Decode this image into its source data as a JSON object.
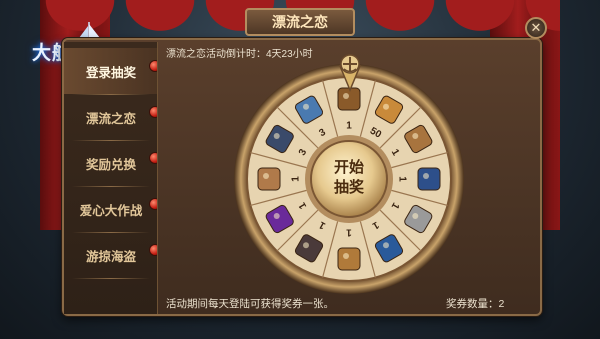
{
  "logo": {
    "title": "大航海之路"
  },
  "header": {
    "title": "漂流之恋",
    "close_label": "✕"
  },
  "countdown": {
    "label": "漂流之恋活动倒计时：",
    "value": "4天23小时"
  },
  "sidebar": {
    "items": [
      {
        "label": "登录抽奖",
        "active": true
      },
      {
        "label": "漂流之恋",
        "active": false
      },
      {
        "label": "奖励兑换",
        "active": false
      },
      {
        "label": "爱心大作战",
        "active": false
      },
      {
        "label": "游掠海盗",
        "active": false
      }
    ]
  },
  "wheel": {
    "button_line1": "开始",
    "button_line2": "抽奖",
    "prize_counts": [
      "1",
      "50",
      "1",
      "1",
      "1",
      "1",
      "1",
      "1",
      "1",
      "1",
      "3",
      "3"
    ],
    "prize_icons": [
      "chest-icon",
      "crate-icon",
      "scroll-icon",
      "book-icon",
      "ring-icon",
      "map-icon",
      "box-icon",
      "anchor-icon",
      "gem-icon",
      "pouch-icon",
      "painting-icon",
      "crystal-icon"
    ]
  },
  "footer": {
    "tip": "活动期间每天登陆可获得奖券一张。",
    "ticket_label": "奖券数量：",
    "ticket_value": "2"
  },
  "colors": {
    "accent": "#c21d12",
    "gold": "#d9b46a",
    "panel": "#4a3322"
  }
}
